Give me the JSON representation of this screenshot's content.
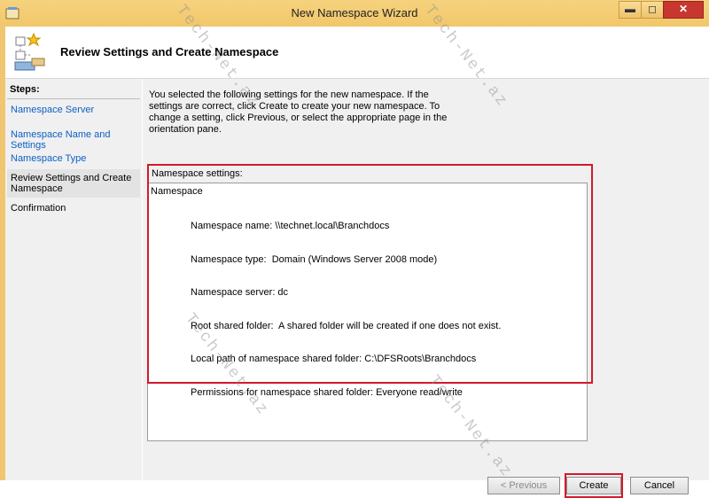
{
  "window": {
    "title": "New Namespace Wizard",
    "minimize": "▬",
    "maximize": "◻",
    "close": "✕"
  },
  "header": {
    "title": "Review Settings and Create Namespace"
  },
  "sidebar": {
    "steps_label": "Steps:",
    "items": [
      {
        "label": "Namespace Server"
      },
      {
        "label": "Namespace Name and Settings"
      },
      {
        "label": "Namespace Type"
      },
      {
        "label": "Review Settings and Create Namespace"
      },
      {
        "label": "Confirmation"
      }
    ]
  },
  "main": {
    "description": "You selected the following settings for the new namespace. If the settings are correct, click Create to create your new namespace. To change a setting, click Previous, or select the appropriate page in the orientation pane.",
    "settings_label": "Namespace settings:",
    "settings_heading": "Namespace",
    "settings_lines": [
      "Namespace name: \\\\technet.local\\Branchdocs",
      "Namespace type:  Domain (Windows Server 2008 mode)",
      "Namespace server: dc",
      "Root shared folder:  A shared folder will be created if one does not exist.",
      "Local path of namespace shared folder: C:\\DFSRoots\\Branchdocs",
      "Permissions for namespace shared folder: Everyone read/write"
    ]
  },
  "buttons": {
    "previous": "< Previous",
    "create": "Create",
    "cancel": "Cancel"
  },
  "watermark": "Tech-Net.az",
  "colors": {
    "titlebar": "#f1c76a",
    "highlight": "#d31a2c",
    "link": "#0b5fc5"
  }
}
